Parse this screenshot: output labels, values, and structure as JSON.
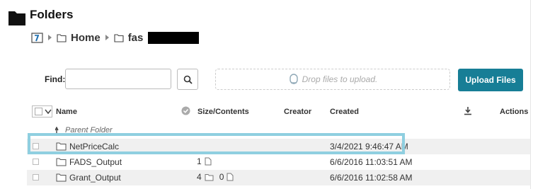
{
  "header": {
    "title": "Folders",
    "icon": "folder-solid-icon"
  },
  "breadcrumb": {
    "home_label": "Home",
    "current_label": "fas",
    "redacted": true
  },
  "toolbar": {
    "find_label": "Find:",
    "find_value": "",
    "find_placeholder": "",
    "dropzone_text": "Drop files to upload.",
    "upload_label": "Upload Files",
    "upload_color": "#177e96"
  },
  "columns": {
    "name": "Name",
    "size": "Size/Contents",
    "creator": "Creator",
    "created": "Created",
    "actions": "Actions"
  },
  "parent_folder_label": "Parent Folder",
  "rows": [
    {
      "name": "NetPriceCalc",
      "files": "",
      "folders": "",
      "created": "3/4/2021 9:46:47 AM",
      "highlighted": true
    },
    {
      "name": "FADS_Output",
      "files": "1",
      "folders": "",
      "created": "6/6/2016 11:03:51 AM",
      "highlighted": false
    },
    {
      "name": "Grant_Output",
      "files": "0",
      "folders": "4",
      "created": "6/6/2016 11:02:58 AM",
      "highlighted": false
    }
  ],
  "colors": {
    "highlight": "#8fcfe0",
    "row_alt": "#f0f0f0"
  }
}
